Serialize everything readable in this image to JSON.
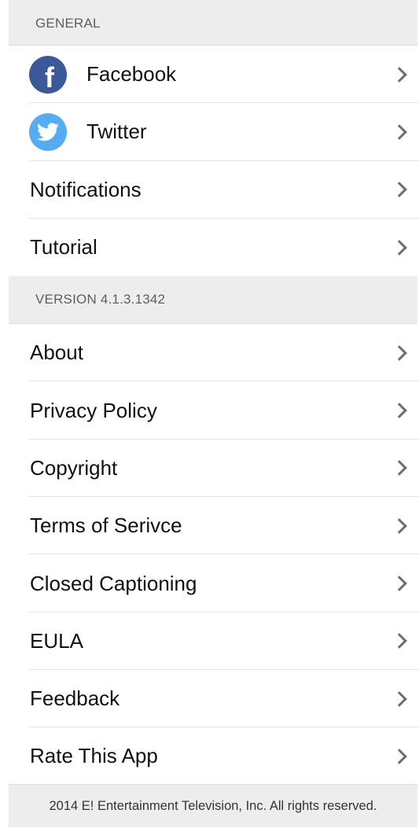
{
  "sections": {
    "general": {
      "header": "GENERAL",
      "items": [
        {
          "label": "Facebook",
          "icon": "facebook-icon"
        },
        {
          "label": "Twitter",
          "icon": "twitter-icon"
        },
        {
          "label": "Notifications"
        },
        {
          "label": "Tutorial"
        }
      ]
    },
    "version": {
      "header": "VERSION 4.1.3.1342",
      "items": [
        {
          "label": "About"
        },
        {
          "label": "Privacy Policy"
        },
        {
          "label": "Copyright"
        },
        {
          "label": "Terms of Serivce"
        },
        {
          "label": "Closed Captioning"
        },
        {
          "label": "EULA"
        },
        {
          "label": "Feedback"
        },
        {
          "label": "Rate This App"
        }
      ]
    }
  },
  "footer": {
    "text": "2014 E! Entertainment Television, Inc. All rights reserved."
  },
  "colors": {
    "facebook": "#3b5998",
    "twitter": "#55acee",
    "section_header_bg": "#ededed",
    "chevron": "#6e6e6e"
  }
}
